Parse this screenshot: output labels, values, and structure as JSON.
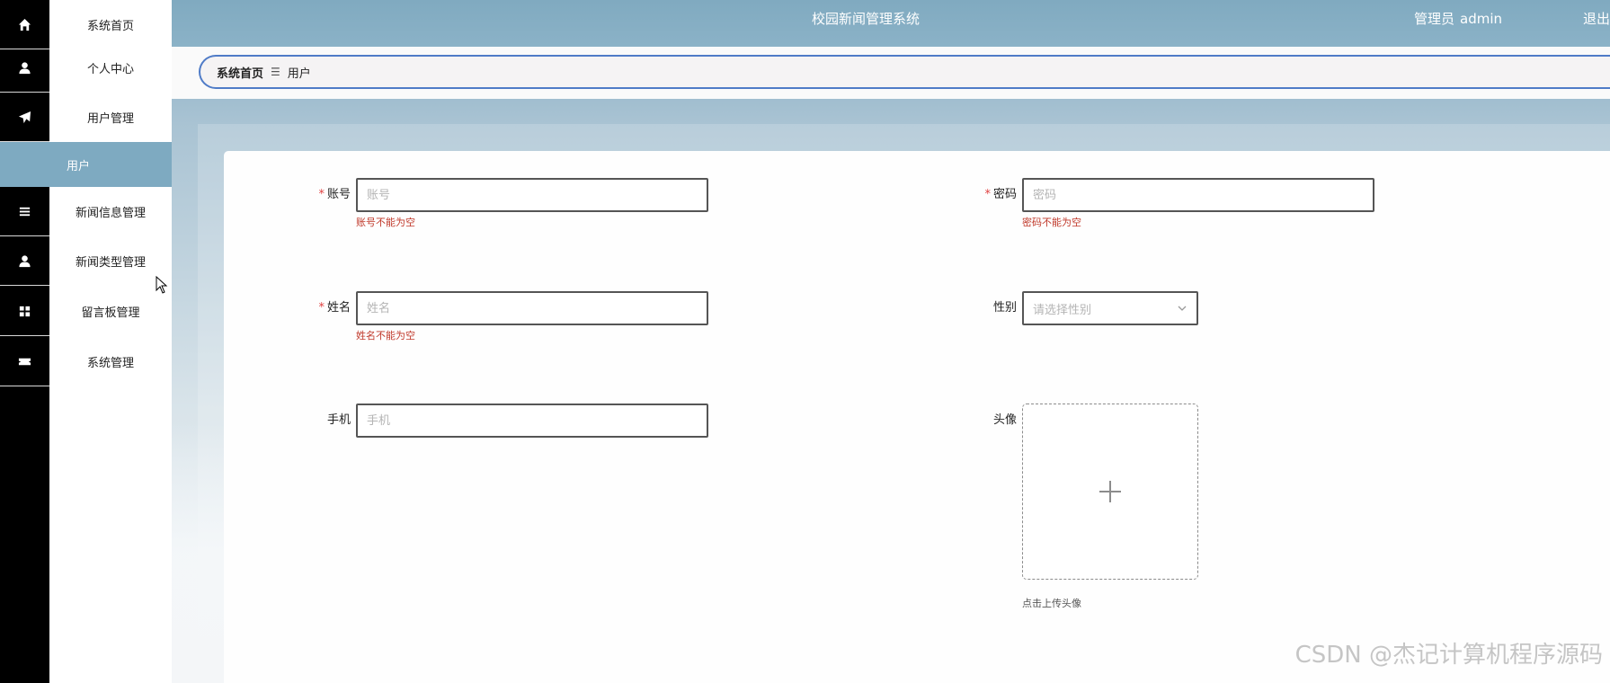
{
  "app": {
    "title": "校园新闻管理系统"
  },
  "header": {
    "role": "管理员",
    "username": "admin",
    "logout_label": "退出"
  },
  "sidebar": {
    "items": [
      {
        "label": "系统首页",
        "icon": "home-icon"
      },
      {
        "label": "个人中心",
        "icon": "user-icon"
      },
      {
        "label": "用户管理",
        "icon": "paper-plane-icon"
      },
      {
        "label": "新闻信息管理",
        "icon": "list-icon"
      },
      {
        "label": "新闻类型管理",
        "icon": "user-icon"
      },
      {
        "label": "留言板管理",
        "icon": "grid-icon"
      },
      {
        "label": "系统管理",
        "icon": "ticket-icon"
      }
    ],
    "active_sub": "用户"
  },
  "breadcrumb": {
    "home": "系统首页",
    "separator": "☰",
    "current": "用户"
  },
  "form": {
    "account": {
      "label": "账号",
      "placeholder": "账号",
      "value": "",
      "error": "账号不能为空"
    },
    "password": {
      "label": "密码",
      "placeholder": "密码",
      "value": "",
      "error": "密码不能为空"
    },
    "name": {
      "label": "姓名",
      "placeholder": "姓名",
      "value": "",
      "error": "姓名不能为空"
    },
    "gender": {
      "label": "性别",
      "placeholder": "请选择性别"
    },
    "phone": {
      "label": "手机",
      "placeholder": "手机",
      "value": ""
    },
    "avatar": {
      "label": "头像",
      "hint": "点击上传头像"
    }
  },
  "watermark": "CSDN @杰记计算机程序源码",
  "colors": {
    "accent": "#7eaac1",
    "breadcrumb_border": "#4f7bc7",
    "error": "#c0392b",
    "required": "#e04040"
  }
}
